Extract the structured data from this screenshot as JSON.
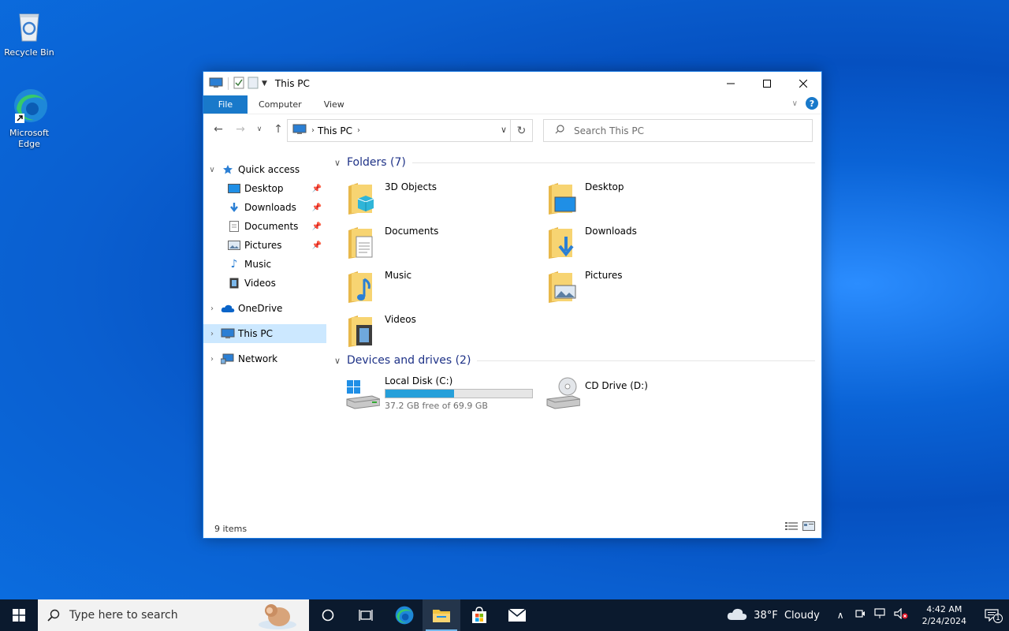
{
  "desktop": {
    "icons": [
      {
        "label": "Recycle Bin"
      },
      {
        "label": "Microsoft Edge"
      }
    ]
  },
  "window": {
    "title": "This PC",
    "ribbon_tabs": [
      "File",
      "Computer",
      "View"
    ],
    "help_label": "?",
    "address": {
      "crumb": "This PC"
    },
    "search": {
      "placeholder": "Search This PC"
    }
  },
  "nav": {
    "quick_access": "Quick access",
    "quick_items": [
      "Desktop",
      "Downloads",
      "Documents",
      "Pictures",
      "Music",
      "Videos"
    ],
    "onedrive": "OneDrive",
    "this_pc": "This PC",
    "network": "Network"
  },
  "content": {
    "folders_header": "Folders (7)",
    "folders": [
      "3D Objects",
      "Desktop",
      "Documents",
      "Downloads",
      "Music",
      "Pictures",
      "Videos"
    ],
    "drives_header": "Devices and drives (2)",
    "drives": [
      {
        "name": "Local Disk (C:)",
        "free_text": "37.2 GB free of 69.9 GB",
        "used_fraction": 0.468
      },
      {
        "name": "CD Drive (D:)"
      }
    ]
  },
  "status": {
    "items": "9 items"
  },
  "taskbar": {
    "search_placeholder": "Type here to search",
    "weather": "38°F  Cloudy",
    "time": "4:42 AM",
    "date": "2/24/2024",
    "notification_count": "1"
  },
  "colors": {
    "accent": "#1979ca",
    "selection": "#cce8ff",
    "drive_fill": "#26a0da",
    "group_header": "#1e3287"
  }
}
